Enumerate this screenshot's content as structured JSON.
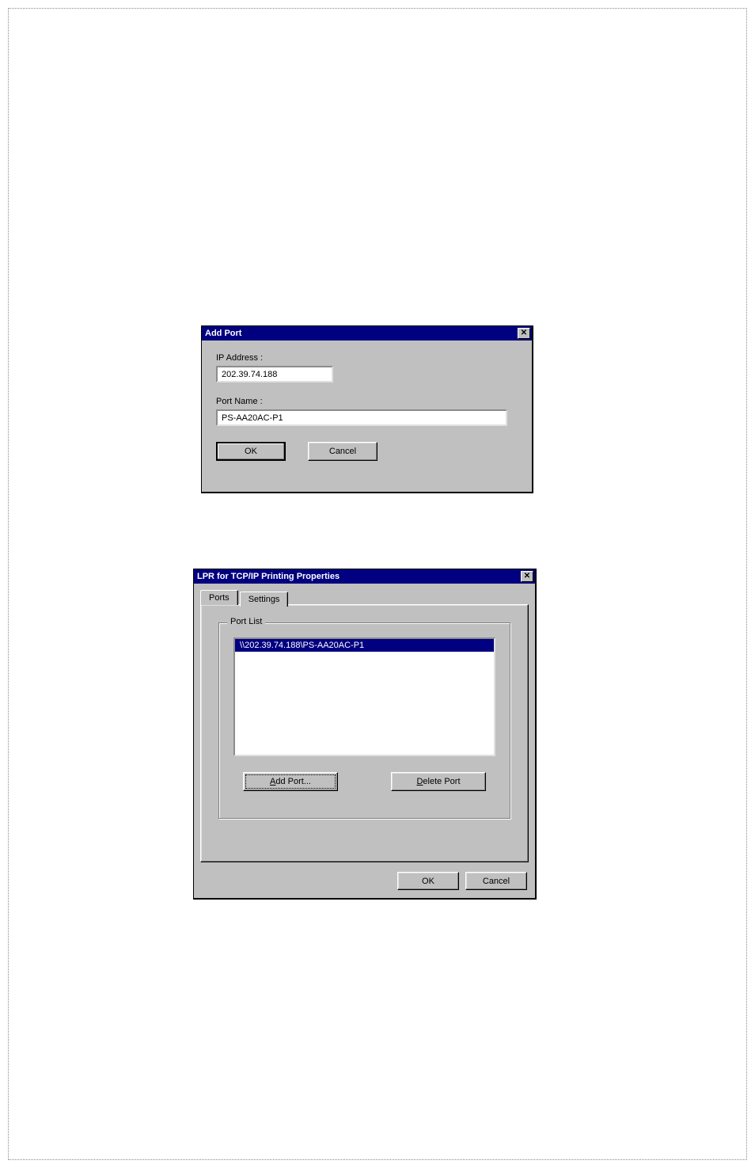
{
  "dlg1": {
    "title": "Add Port",
    "ip_label": "IP Address :",
    "ip_value": "202.39.74.188",
    "portname_label": "Port Name :",
    "portname_value": "PS-AA20AC-P1",
    "ok_label": "OK",
    "cancel_label": "Cancel"
  },
  "dlg2": {
    "title": "LPR for TCP/IP Printing Properties",
    "tabs": {
      "ports": "Ports",
      "settings": "Settings"
    },
    "groupbox_legend": "Port List",
    "list_items": [
      "\\\\202.39.74.188\\PS-AA20AC-P1"
    ],
    "addport_prefix": "A",
    "addport_rest": "dd Port...",
    "deleteport_prefix": "D",
    "deleteport_rest": "elete Port",
    "ok_label": "OK",
    "cancel_label": "Cancel"
  }
}
